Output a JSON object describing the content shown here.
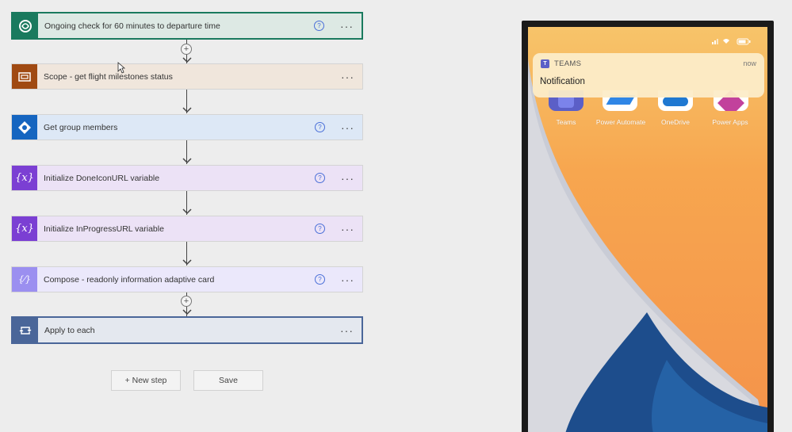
{
  "flow": {
    "steps": [
      {
        "title": "Ongoing check for 60 minutes to departure time",
        "icon": "dataverse-icon",
        "color": "#1a7a5e",
        "bg": "#dde9e4",
        "help": "?",
        "more": "···"
      },
      {
        "title": "Scope - get flight milestones status",
        "icon": "scope-icon",
        "color": "#a04a12",
        "bg": "#f0e6dc",
        "help": "",
        "more": "···"
      },
      {
        "title": "Get group members",
        "icon": "azure-ad-icon",
        "color": "#1565c0",
        "bg": "#dde8f6",
        "help": "?",
        "more": "···"
      },
      {
        "title": "Initialize DoneIconURL variable",
        "icon": "variable-icon",
        "color": "#7b3fd3",
        "bg": "#ece2f6",
        "help": "?",
        "more": "···"
      },
      {
        "title": "Initialize InProgressURL variable",
        "icon": "variable-icon",
        "color": "#7b3fd3",
        "bg": "#ece2f6",
        "help": "?",
        "more": "···"
      },
      {
        "title": "Compose - readonly information adaptive card",
        "icon": "compose-icon",
        "color": "#9b8ff0",
        "bg": "#ebe8fb",
        "help": "?",
        "more": "···"
      },
      {
        "title": "Apply to each",
        "icon": "loop-icon",
        "color": "#4a6699",
        "bg": "#e4e8ef",
        "help": "",
        "more": "···"
      }
    ],
    "new_step_label": "+ New step",
    "save_label": "Save"
  },
  "phone": {
    "notification": {
      "app": "TEAMS",
      "time": "now",
      "text": "Notification"
    },
    "apps": [
      {
        "label": "Teams",
        "icon": "teams-icon"
      },
      {
        "label": "Power Automate",
        "icon": "power-automate-icon"
      },
      {
        "label": "OneDrive",
        "icon": "onedrive-icon"
      },
      {
        "label": "Power Apps",
        "icon": "power-apps-icon"
      }
    ]
  }
}
